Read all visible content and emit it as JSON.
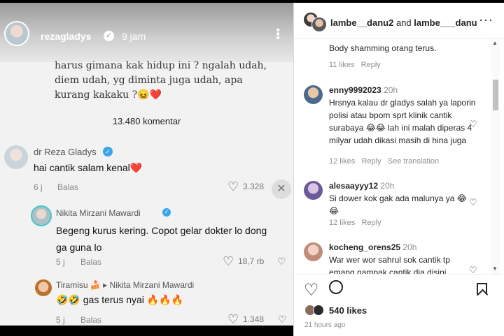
{
  "story": {
    "username": "rezagladys",
    "time": "9 jam",
    "post_text": "harus gimana kak hidup ini ? ngalah udah, diem udah, yg diminta juga udah, apa kurang kakaku ?😖❤️",
    "comment_count": "13.480 komentar",
    "comments": [
      {
        "name": "dr Reza Gladys",
        "text": "hai cantik salam kenal❤️",
        "time": "6 j",
        "reply": "Balas",
        "likes": "3.328"
      },
      {
        "name": "Nikita Mirzani Mawardi",
        "text": "Begeng kurus kering. Copot gelar dokter lo dong ga guna lo",
        "time": "5 j",
        "reply": "Balas",
        "likes": "18,7 rb"
      },
      {
        "name": "Tiramisu 🍰 ▸ Nikita Mirzani Mawardi",
        "text": "🤣🤣 gas terus nyai 🔥🔥🔥",
        "time": "5 j",
        "reply": "Balas",
        "likes": "1.348"
      }
    ]
  },
  "panel": {
    "header_user1": "lambe__danu2",
    "header_and": "and",
    "header_user2": "lambe___danu",
    "comments": [
      {
        "text": "Body shamming orang terus.",
        "likes": "11 likes",
        "reply": "Reply"
      },
      {
        "user": "enny9992023",
        "time": "20h",
        "text": "Hrsnya kalau dr gladys salah ya laporin polisi atau bpom sprt klinik cantik surabaya 😂😂 lah ini malah diperas 4 milyar udah dikasi masih di hina juga",
        "likes": "12 likes",
        "reply": "Reply",
        "translate": "See translation"
      },
      {
        "user": "alesaayyy12",
        "time": "20h",
        "text": "Si dower kok gak ada malunya ya 😂😂",
        "likes": "12 likes",
        "reply": "Reply"
      },
      {
        "user": "kocheng_orens25",
        "time": "20h",
        "text": "War wer wor sahrul sok cantik tp emang nampak cantik dia disini,"
      }
    ],
    "likes_count": "540 likes",
    "posted": "21 hours ago"
  }
}
